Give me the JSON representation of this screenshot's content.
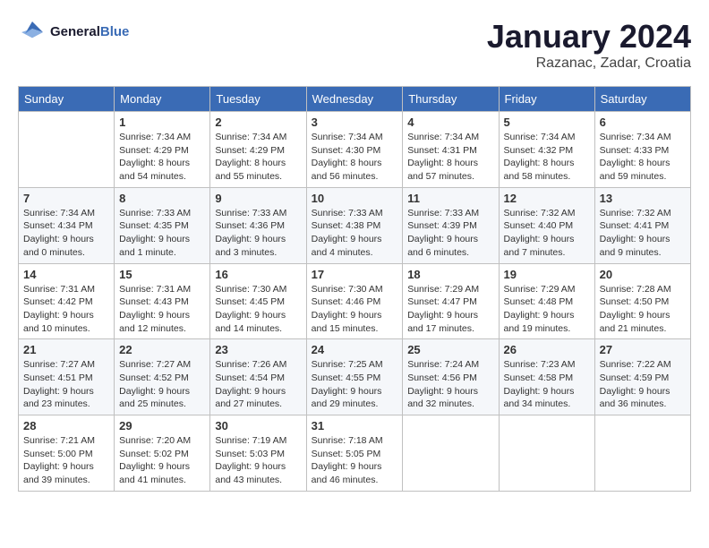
{
  "header": {
    "logo_text_general": "General",
    "logo_text_blue": "Blue",
    "title": "January 2024",
    "subtitle": "Razanac, Zadar, Croatia"
  },
  "calendar": {
    "days_of_week": [
      "Sunday",
      "Monday",
      "Tuesday",
      "Wednesday",
      "Thursday",
      "Friday",
      "Saturday"
    ],
    "weeks": [
      [
        {
          "day": "",
          "sunrise": "",
          "sunset": "",
          "daylight": ""
        },
        {
          "day": "1",
          "sunrise": "Sunrise: 7:34 AM",
          "sunset": "Sunset: 4:29 PM",
          "daylight": "Daylight: 8 hours and 54 minutes."
        },
        {
          "day": "2",
          "sunrise": "Sunrise: 7:34 AM",
          "sunset": "Sunset: 4:29 PM",
          "daylight": "Daylight: 8 hours and 55 minutes."
        },
        {
          "day": "3",
          "sunrise": "Sunrise: 7:34 AM",
          "sunset": "Sunset: 4:30 PM",
          "daylight": "Daylight: 8 hours and 56 minutes."
        },
        {
          "day": "4",
          "sunrise": "Sunrise: 7:34 AM",
          "sunset": "Sunset: 4:31 PM",
          "daylight": "Daylight: 8 hours and 57 minutes."
        },
        {
          "day": "5",
          "sunrise": "Sunrise: 7:34 AM",
          "sunset": "Sunset: 4:32 PM",
          "daylight": "Daylight: 8 hours and 58 minutes."
        },
        {
          "day": "6",
          "sunrise": "Sunrise: 7:34 AM",
          "sunset": "Sunset: 4:33 PM",
          "daylight": "Daylight: 8 hours and 59 minutes."
        }
      ],
      [
        {
          "day": "7",
          "sunrise": "Sunrise: 7:34 AM",
          "sunset": "Sunset: 4:34 PM",
          "daylight": "Daylight: 9 hours and 0 minutes."
        },
        {
          "day": "8",
          "sunrise": "Sunrise: 7:33 AM",
          "sunset": "Sunset: 4:35 PM",
          "daylight": "Daylight: 9 hours and 1 minute."
        },
        {
          "day": "9",
          "sunrise": "Sunrise: 7:33 AM",
          "sunset": "Sunset: 4:36 PM",
          "daylight": "Daylight: 9 hours and 3 minutes."
        },
        {
          "day": "10",
          "sunrise": "Sunrise: 7:33 AM",
          "sunset": "Sunset: 4:38 PM",
          "daylight": "Daylight: 9 hours and 4 minutes."
        },
        {
          "day": "11",
          "sunrise": "Sunrise: 7:33 AM",
          "sunset": "Sunset: 4:39 PM",
          "daylight": "Daylight: 9 hours and 6 minutes."
        },
        {
          "day": "12",
          "sunrise": "Sunrise: 7:32 AM",
          "sunset": "Sunset: 4:40 PM",
          "daylight": "Daylight: 9 hours and 7 minutes."
        },
        {
          "day": "13",
          "sunrise": "Sunrise: 7:32 AM",
          "sunset": "Sunset: 4:41 PM",
          "daylight": "Daylight: 9 hours and 9 minutes."
        }
      ],
      [
        {
          "day": "14",
          "sunrise": "Sunrise: 7:31 AM",
          "sunset": "Sunset: 4:42 PM",
          "daylight": "Daylight: 9 hours and 10 minutes."
        },
        {
          "day": "15",
          "sunrise": "Sunrise: 7:31 AM",
          "sunset": "Sunset: 4:43 PM",
          "daylight": "Daylight: 9 hours and 12 minutes."
        },
        {
          "day": "16",
          "sunrise": "Sunrise: 7:30 AM",
          "sunset": "Sunset: 4:45 PM",
          "daylight": "Daylight: 9 hours and 14 minutes."
        },
        {
          "day": "17",
          "sunrise": "Sunrise: 7:30 AM",
          "sunset": "Sunset: 4:46 PM",
          "daylight": "Daylight: 9 hours and 15 minutes."
        },
        {
          "day": "18",
          "sunrise": "Sunrise: 7:29 AM",
          "sunset": "Sunset: 4:47 PM",
          "daylight": "Daylight: 9 hours and 17 minutes."
        },
        {
          "day": "19",
          "sunrise": "Sunrise: 7:29 AM",
          "sunset": "Sunset: 4:48 PM",
          "daylight": "Daylight: 9 hours and 19 minutes."
        },
        {
          "day": "20",
          "sunrise": "Sunrise: 7:28 AM",
          "sunset": "Sunset: 4:50 PM",
          "daylight": "Daylight: 9 hours and 21 minutes."
        }
      ],
      [
        {
          "day": "21",
          "sunrise": "Sunrise: 7:27 AM",
          "sunset": "Sunset: 4:51 PM",
          "daylight": "Daylight: 9 hours and 23 minutes."
        },
        {
          "day": "22",
          "sunrise": "Sunrise: 7:27 AM",
          "sunset": "Sunset: 4:52 PM",
          "daylight": "Daylight: 9 hours and 25 minutes."
        },
        {
          "day": "23",
          "sunrise": "Sunrise: 7:26 AM",
          "sunset": "Sunset: 4:54 PM",
          "daylight": "Daylight: 9 hours and 27 minutes."
        },
        {
          "day": "24",
          "sunrise": "Sunrise: 7:25 AM",
          "sunset": "Sunset: 4:55 PM",
          "daylight": "Daylight: 9 hours and 29 minutes."
        },
        {
          "day": "25",
          "sunrise": "Sunrise: 7:24 AM",
          "sunset": "Sunset: 4:56 PM",
          "daylight": "Daylight: 9 hours and 32 minutes."
        },
        {
          "day": "26",
          "sunrise": "Sunrise: 7:23 AM",
          "sunset": "Sunset: 4:58 PM",
          "daylight": "Daylight: 9 hours and 34 minutes."
        },
        {
          "day": "27",
          "sunrise": "Sunrise: 7:22 AM",
          "sunset": "Sunset: 4:59 PM",
          "daylight": "Daylight: 9 hours and 36 minutes."
        }
      ],
      [
        {
          "day": "28",
          "sunrise": "Sunrise: 7:21 AM",
          "sunset": "Sunset: 5:00 PM",
          "daylight": "Daylight: 9 hours and 39 minutes."
        },
        {
          "day": "29",
          "sunrise": "Sunrise: 7:20 AM",
          "sunset": "Sunset: 5:02 PM",
          "daylight": "Daylight: 9 hours and 41 minutes."
        },
        {
          "day": "30",
          "sunrise": "Sunrise: 7:19 AM",
          "sunset": "Sunset: 5:03 PM",
          "daylight": "Daylight: 9 hours and 43 minutes."
        },
        {
          "day": "31",
          "sunrise": "Sunrise: 7:18 AM",
          "sunset": "Sunset: 5:05 PM",
          "daylight": "Daylight: 9 hours and 46 minutes."
        },
        {
          "day": "",
          "sunrise": "",
          "sunset": "",
          "daylight": ""
        },
        {
          "day": "",
          "sunrise": "",
          "sunset": "",
          "daylight": ""
        },
        {
          "day": "",
          "sunrise": "",
          "sunset": "",
          "daylight": ""
        }
      ]
    ]
  }
}
